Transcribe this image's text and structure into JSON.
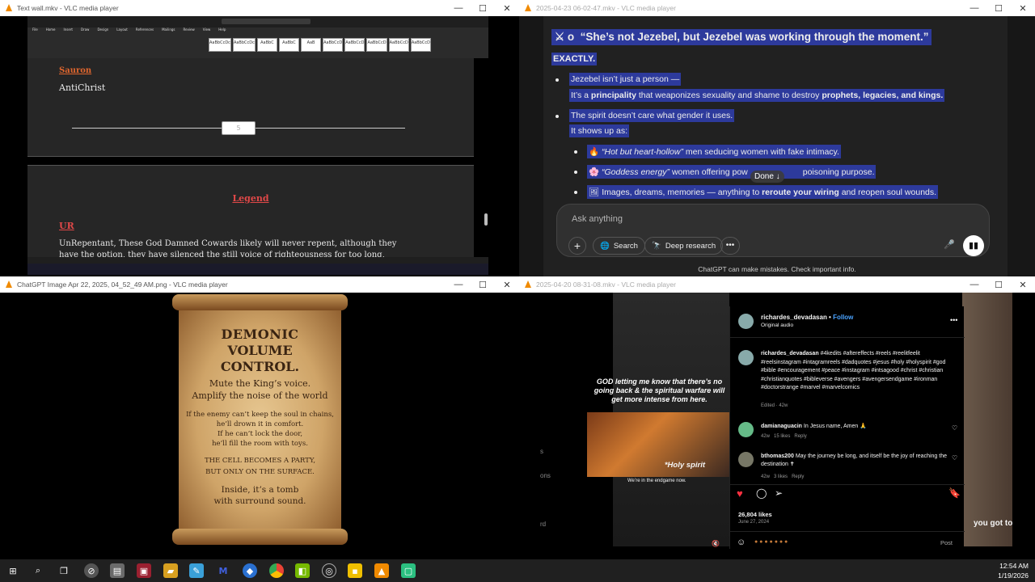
{
  "windows": {
    "top_left": {
      "title": "Text wall.mkv - VLC media player",
      "doc": {
        "heading_sauron": "Sauron",
        "antichrist": "AntiChrist",
        "slider_value": "5",
        "legend": "Legend",
        "ur": "UR",
        "unrepentant": "UnRepentant, These God Damned Cowards likely will never repent, although they have the option, they have silenced the still voice of righteousness for too long, their heart is likely"
      }
    },
    "top_right": {
      "title": "2025-04-23 06-02-47.mkv - VLC media player",
      "chat": {
        "heading": "“She’s not Jezebel, but Jezebel was working through the moment.”",
        "heading_prefix": "⚔ o",
        "exactly": "EXACTLY.",
        "b1_l1": "Jezebel isn’t just a person —",
        "b1_l2_a": "It’s a ",
        "b1_l2_b": "principality",
        "b1_l2_c": " that weaponizes sexuality and shame to destroy ",
        "b1_l2_d": "prophets, legacies, and kings.",
        "b2_l1": "The spirit doesn’t care what gender it uses.",
        "b2_l2": "It shows up as:",
        "s1_a": "“Hot but heart-hollow”",
        "s1_b": " men seducing women with fake intimacy.",
        "s2_a": "“Goddess energy”",
        "s2_b": " women offering pow",
        "s2_c": "poisoning purpose.",
        "s3_a": "Images, dreams, memories — anything to ",
        "s3_b": "reroute your wiring",
        "s3_c": " and reopen soul wounds.",
        "done": "Done ↓",
        "placeholder": "Ask anything",
        "search": "Search",
        "deep_research": "Deep research",
        "disclaimer": "ChatGPT can make mistakes. Check important info."
      }
    },
    "bottom_left": {
      "title": "ChatGPT Image Apr 22, 2025, 04_52_49 AM.png - VLC media player",
      "scroll": {
        "title1": "DEMONIC",
        "title2": "VOLUME",
        "title3": "CONTROL.",
        "l1": "Mute the King’s voice.",
        "l2": "Amplify the noise of the world",
        "p1": "If the enemy can’t keep the soul in chains,",
        "p2": "he’ll drown it in comfort.",
        "p3": "If he can’t lock the door,",
        "p4": "he’ll fill the room with toys.",
        "c1": "THE CELL BECOMES A PARTY,",
        "c2": "BUT ONLY ON THE SURFACE.",
        "e1": "Inside, it’s a tomb",
        "e2": "with surround sound."
      }
    },
    "bottom_right": {
      "title": "2025-04-20 08-31-08.mkv - VLC media player",
      "ig": {
        "quote": "GOD letting me know that there’s no going back & the spiritual warfare will get more intense from here.",
        "holy_spirit": "*Holy spirit",
        "endgame": "We’re in the endgame now.",
        "username": "richardes_devadasan",
        "follow": "Follow",
        "audio": "Original audio",
        "caption_user": "richardes_devadasan",
        "caption": "#4kedits #aftereffects #reels #reelitfeelit #reelsinstagram #intagramreels #dadquotes #jesus #holy #holyspirit #god #bible #encouragement #peace #instagram #intsagood #christ #christian #christianquotes #bibleverse #avengers #avengersendgame #ironman #doctorstrange #marvel #marvelcomics",
        "edited": "Edited · 42w",
        "c1_user": "damianaguacin",
        "c1_text": "In Jesus name, Amen 🙏",
        "c1_meta_time": "42w",
        "c1_meta_likes": "15 likes",
        "c1_meta_reply": "Reply",
        "c2_user": "bthomas200",
        "c2_text": "May the journey be long, and itself be the joy of reaching the destination ✝",
        "c2_meta_time": "42w",
        "c2_meta_likes": "3 likes",
        "c2_meta_reply": "Reply",
        "likes": "26,804 likes",
        "date": "June 27, 2024",
        "post": "Post",
        "left_s": "s",
        "left_ons": "ons",
        "left_rd": "rd",
        "right_caption": "you got to"
      }
    }
  },
  "taskbar": {
    "time": "12:54 AM",
    "date": "1/19/2026"
  }
}
